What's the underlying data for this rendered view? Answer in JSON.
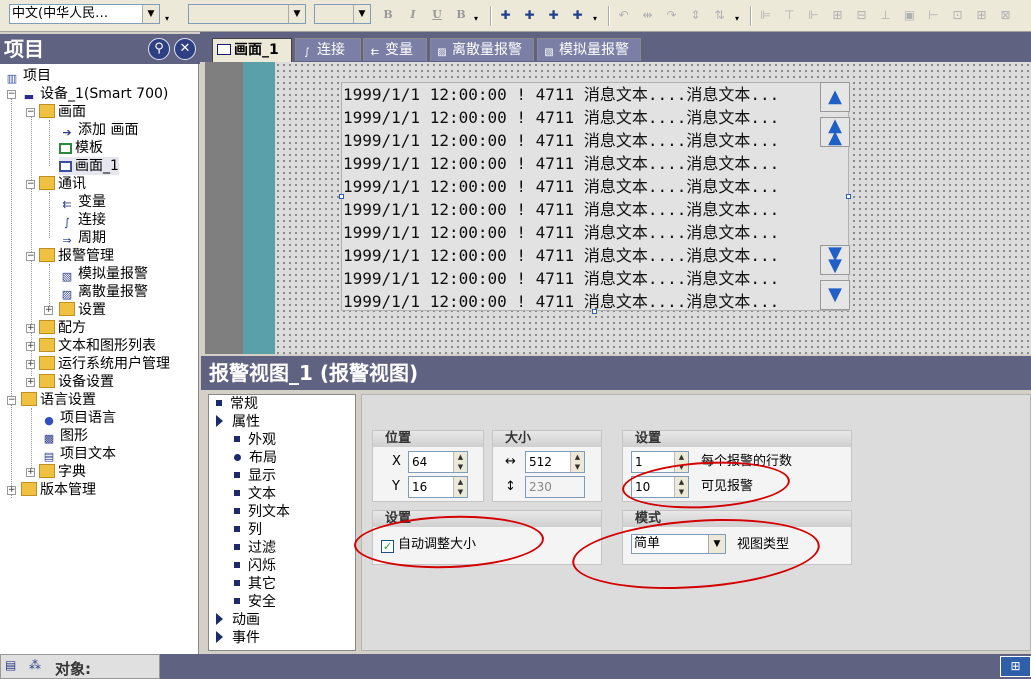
{
  "toolbar": {
    "language_value": "中文(中华人民…",
    "font_value": "",
    "size_value": "",
    "bold_label": "B",
    "italic_label": "I",
    "underline_label": "U",
    "strike_label": "B"
  },
  "project": {
    "title": "项目",
    "tree": [
      {
        "id": "root",
        "label": "项目"
      },
      {
        "id": "device",
        "label": "设备_1(Smart 700)"
      },
      {
        "id": "screens",
        "label": "画面"
      },
      {
        "id": "add_screen",
        "label": "添加 画面"
      },
      {
        "id": "template",
        "label": "模板"
      },
      {
        "id": "screen_1",
        "label": "画面_1"
      },
      {
        "id": "comm",
        "label": "通讯"
      },
      {
        "id": "tags",
        "label": "变量"
      },
      {
        "id": "connections",
        "label": "连接"
      },
      {
        "id": "cycles",
        "label": "周期"
      },
      {
        "id": "alarm_mgmt",
        "label": "报警管理"
      },
      {
        "id": "analog_alarms",
        "label": "模拟量报警"
      },
      {
        "id": "discrete_alarms",
        "label": "离散量报警"
      },
      {
        "id": "alarm_settings",
        "label": "设置"
      },
      {
        "id": "recipes",
        "label": "配方"
      },
      {
        "id": "text_graphics",
        "label": "文本和图形列表"
      },
      {
        "id": "runtime_users",
        "label": "运行系统用户管理"
      },
      {
        "id": "device_settings",
        "label": "设备设置"
      },
      {
        "id": "lang_settings",
        "label": "语言设置"
      },
      {
        "id": "project_lang",
        "label": "项目语言"
      },
      {
        "id": "graphics",
        "label": "图形"
      },
      {
        "id": "project_texts",
        "label": "项目文本"
      },
      {
        "id": "dictionary",
        "label": "字典"
      },
      {
        "id": "version_mgmt",
        "label": "版本管理"
      }
    ]
  },
  "tabs": [
    "画面_1",
    "连接",
    "变量",
    "离散量报警",
    "模拟量报警"
  ],
  "alarm_rows": [
    "1999/1/1 12:00:00 ! 4711 消息文本....消息文本...",
    "1999/1/1 12:00:00 ! 4711 消息文本....消息文本...",
    "1999/1/1 12:00:00 ! 4711 消息文本....消息文本...",
    "1999/1/1 12:00:00 ! 4711 消息文本....消息文本...",
    "1999/1/1 12:00:00 ! 4711 消息文本....消息文本...",
    "1999/1/1 12:00:00 ! 4711 消息文本....消息文本...",
    "1999/1/1 12:00:00 ! 4711 消息文本....消息文本...",
    "1999/1/1 12:00:00 ! 4711 消息文本....消息文本...",
    "1999/1/1 12:00:00 ! 4711 消息文本....消息文本...",
    "1999/1/1 12:00:00 ! 4711 消息文本....消息文本..."
  ],
  "properties": {
    "title": "报警视图_1 (报警视图)",
    "categories": [
      {
        "label": "常规",
        "kind": "bullet"
      },
      {
        "label": "属性",
        "kind": "arrow"
      },
      {
        "label": "外观",
        "kind": "bullet"
      },
      {
        "label": "布局",
        "kind": "selected"
      },
      {
        "label": "显示",
        "kind": "bullet"
      },
      {
        "label": "文本",
        "kind": "bullet"
      },
      {
        "label": "列文本",
        "kind": "bullet"
      },
      {
        "label": "列",
        "kind": "bullet"
      },
      {
        "label": "过滤",
        "kind": "bullet"
      },
      {
        "label": "闪烁",
        "kind": "bullet"
      },
      {
        "label": "其它",
        "kind": "bullet"
      },
      {
        "label": "安全",
        "kind": "bullet"
      },
      {
        "label": "动画",
        "kind": "arrow"
      },
      {
        "label": "事件",
        "kind": "arrow"
      }
    ],
    "position": {
      "header": "位置",
      "x_label": "X",
      "x_value": "64",
      "y_label": "Y",
      "y_value": "16"
    },
    "size": {
      "header": "大小",
      "w_icon": "↔",
      "w_value": "512",
      "h_icon": "↕",
      "h_value": "230"
    },
    "settings": {
      "header": "设置",
      "rows_value": "1",
      "rows_label": "每个报警的行数",
      "visible_value": "10",
      "visible_label": "可见报警"
    },
    "autosize": {
      "header": "设置",
      "check_mark": "✓",
      "label": "自动调整大小"
    },
    "mode": {
      "header": "模式",
      "value": "简单",
      "label": "视图类型"
    }
  },
  "status": {
    "object_label": "对象:"
  },
  "colors": {
    "pane_header": "#5f6281",
    "canvas_teal": "#5aa0a8",
    "scroll_blue": "#1f5fc6",
    "annotation_red": "#d40000"
  }
}
